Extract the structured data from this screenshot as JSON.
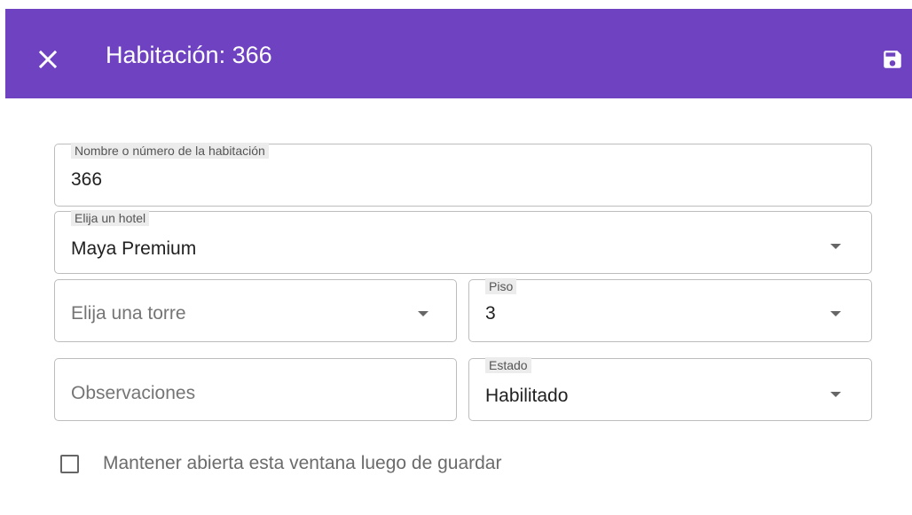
{
  "header": {
    "title": "Habitación: 366",
    "close_icon": "close-icon",
    "save_icon": "save-icon",
    "background_color": "#6f42c1"
  },
  "form": {
    "room_name": {
      "label": "Nombre o número de la habitación",
      "value": "366"
    },
    "hotel": {
      "label": "Elija un hotel",
      "value": "Maya Premium"
    },
    "tower": {
      "placeholder": "Elija una torre"
    },
    "floor": {
      "label": "Piso",
      "value": "3"
    },
    "observations": {
      "placeholder": "Observaciones"
    },
    "status": {
      "label": "Estado",
      "value": "Habilitado"
    },
    "keep_open": {
      "label": "Mantener abierta esta ventana luego de guardar",
      "checked": false
    }
  }
}
